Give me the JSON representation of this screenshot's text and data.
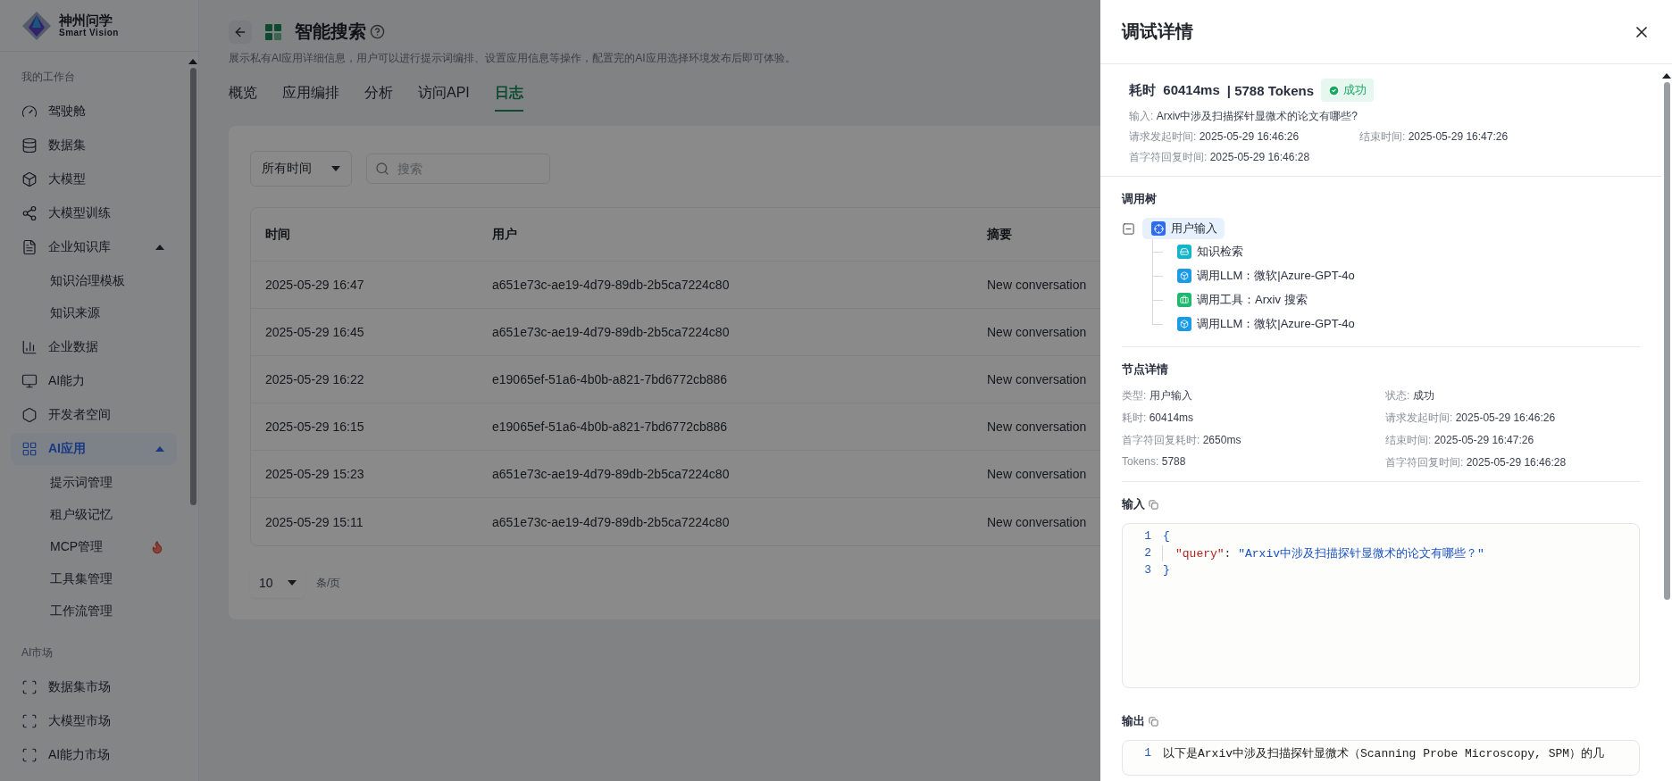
{
  "sidebar": {
    "logo": {
      "name": "神州问学",
      "subtitle": "Smart Vision"
    },
    "sections": [
      {
        "title": "我的工作台",
        "items": [
          {
            "label": "驾驶舱",
            "selected": false
          },
          {
            "label": "数据集",
            "selected": false
          },
          {
            "label": "大模型",
            "selected": false
          },
          {
            "label": "大模型训练",
            "selected": false
          },
          {
            "label": "企业知识库",
            "selected": false,
            "expanded": true,
            "children": [
              {
                "label": "知识治理模板",
                "hot": false
              },
              {
                "label": "知识来源",
                "hot": false
              }
            ]
          },
          {
            "label": "企业数据",
            "selected": false
          },
          {
            "label": "AI能力",
            "selected": false
          },
          {
            "label": "开发者空间",
            "selected": false
          },
          {
            "label": "AI应用",
            "selected": true,
            "expanded": true,
            "children": [
              {
                "label": "提示词管理",
                "hot": false
              },
              {
                "label": "租户级记忆",
                "hot": false
              },
              {
                "label": "MCP管理",
                "hot": true
              },
              {
                "label": "工具集管理",
                "hot": false
              },
              {
                "label": "工作流管理",
                "hot": false
              }
            ]
          }
        ]
      },
      {
        "title": "AI市场",
        "items": [
          {
            "label": "数据集市场",
            "selected": false
          },
          {
            "label": "大模型市场",
            "selected": false
          },
          {
            "label": "AI能力市场",
            "selected": false
          }
        ]
      }
    ]
  },
  "main": {
    "title": "智能搜索",
    "description": "展示私有AI应用详细信息，用户可以进行提示词编排、设置应用信息等操作，配置完的AI应用选择环境发布后即可体验。",
    "tabs": [
      {
        "label": "概览",
        "selected": false
      },
      {
        "label": "应用编排",
        "selected": false
      },
      {
        "label": "分析",
        "selected": false
      },
      {
        "label": "访问API",
        "selected": false
      },
      {
        "label": "日志",
        "selected": true
      }
    ],
    "filter": {
      "value": "所有时间"
    },
    "search": {
      "placeholder": "搜索"
    },
    "table": {
      "columns": [
        "时间",
        "用户",
        "摘要"
      ],
      "rows": [
        [
          "2025-05-29 16:47",
          "a651e73c-ae19-4d79-89db-2b5ca7224c80",
          "New conversation"
        ],
        [
          "2025-05-29 16:45",
          "a651e73c-ae19-4d79-89db-2b5ca7224c80",
          "New conversation"
        ],
        [
          "2025-05-29 16:22",
          "e19065ef-51a6-4b0b-a821-7bd6772cb886",
          "New conversation"
        ],
        [
          "2025-05-29 16:15",
          "e19065ef-51a6-4b0b-a821-7bd6772cb886",
          "New conversation"
        ],
        [
          "2025-05-29 15:23",
          "a651e73c-ae19-4d79-89db-2b5ca7224c80",
          "New conversation"
        ],
        [
          "2025-05-29 15:11",
          "a651e73c-ae19-4d79-89db-2b5ca7224c80",
          "New conversation"
        ]
      ]
    },
    "pagination": {
      "page_size": "10",
      "unit": "条/页"
    }
  },
  "drawer": {
    "title": "调试详情",
    "summary": {
      "duration_label": "耗时",
      "duration": "60414ms",
      "separator": "|",
      "tokens": "5788 Tokens",
      "status": {
        "label": "成功",
        "kind": "success"
      },
      "fields": [
        {
          "label": "输入:",
          "value": "Arxiv中涉及扫描探针显微术的论文有哪些?"
        },
        {
          "label": "请求发起时间:",
          "value": "2025-05-29 16:46:26"
        },
        {
          "label": "结束时间:",
          "value": "2025-05-29 16:47:26"
        },
        {
          "label": "首字符回复时间:",
          "value": "2025-05-29 16:46:28"
        }
      ]
    },
    "tree": {
      "title": "调用树",
      "root": {
        "label": "用户输入",
        "expanded": true,
        "selected": true,
        "children": [
          {
            "label": "知识检索",
            "kind": "retrieval"
          },
          {
            "label": "调用LLM：微软|Azure-GPT-4o",
            "kind": "llm"
          },
          {
            "label": "调用工具：Arxiv 搜索",
            "kind": "tool"
          },
          {
            "label": "调用LLM：微软|Azure-GPT-4o",
            "kind": "llm"
          }
        ]
      }
    },
    "node_details": {
      "title": "节点详情",
      "fields": [
        {
          "label": "类型:",
          "value": "用户输入"
        },
        {
          "label": "状态:",
          "value": "成功"
        },
        {
          "label": "耗时:",
          "value": "60414ms"
        },
        {
          "label": "请求发起时间:",
          "value": "2025-05-29 16:46:26"
        },
        {
          "label": "首字符回复耗时:",
          "value": "2650ms"
        },
        {
          "label": "结束时间:",
          "value": "2025-05-29 16:47:26"
        },
        {
          "label": "Tokens:",
          "value": "5788"
        },
        {
          "label": "首字符回复时间:",
          "value": "2025-05-29 16:46:28"
        }
      ]
    },
    "input": {
      "title": "输入",
      "lines": [
        {
          "number": "1",
          "indent": false,
          "tokens": [
            {
              "text": "{",
              "kind": "brace"
            }
          ]
        },
        {
          "number": "2",
          "indent": true,
          "tokens": [
            {
              "text": "\"query\"",
              "kind": "key"
            },
            {
              "text": ": ",
              "kind": "punct"
            },
            {
              "text": "\"Arxiv中涉及扫描探针显微术的论文有哪些？\"",
              "kind": "string"
            }
          ]
        },
        {
          "number": "3",
          "indent": false,
          "tokens": [
            {
              "text": "}",
              "kind": "brace"
            }
          ]
        }
      ]
    },
    "output": {
      "title": "输出",
      "lines": [
        {
          "number": "1",
          "indent": false,
          "tokens": [
            {
              "text": "以下是Arxiv中涉及扫描探针显微术（Scanning Probe Microscopy, SPM）的几",
              "kind": "plain"
            }
          ]
        }
      ]
    }
  }
}
